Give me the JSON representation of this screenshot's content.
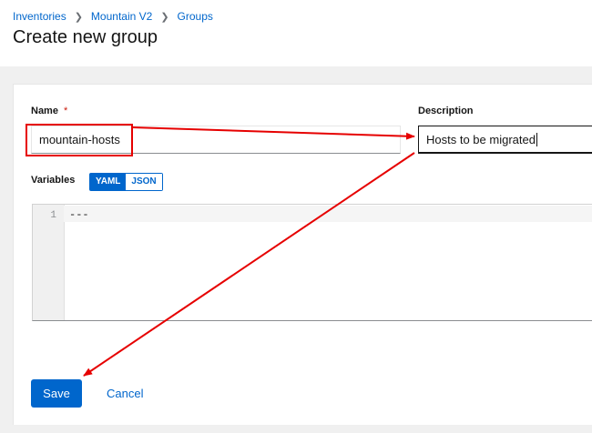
{
  "breadcrumb": {
    "items": [
      "Inventories",
      "Mountain V2",
      "Groups"
    ]
  },
  "page": {
    "title": "Create new group"
  },
  "form": {
    "name_label": "Name",
    "required_marker": "*",
    "name_value": "mountain-hosts",
    "description_label": "Description",
    "description_value": "Hosts to be migrated",
    "variables_label": "Variables",
    "toggle_yaml": "YAML",
    "toggle_json": "JSON",
    "selected_format": "YAML",
    "editor": {
      "line_number": "1",
      "content": "---"
    }
  },
  "actions": {
    "save_label": "Save",
    "cancel_label": "Cancel"
  },
  "colors": {
    "accent": "#0066cc",
    "annotation": "#e60000",
    "required": "#c9190b"
  }
}
